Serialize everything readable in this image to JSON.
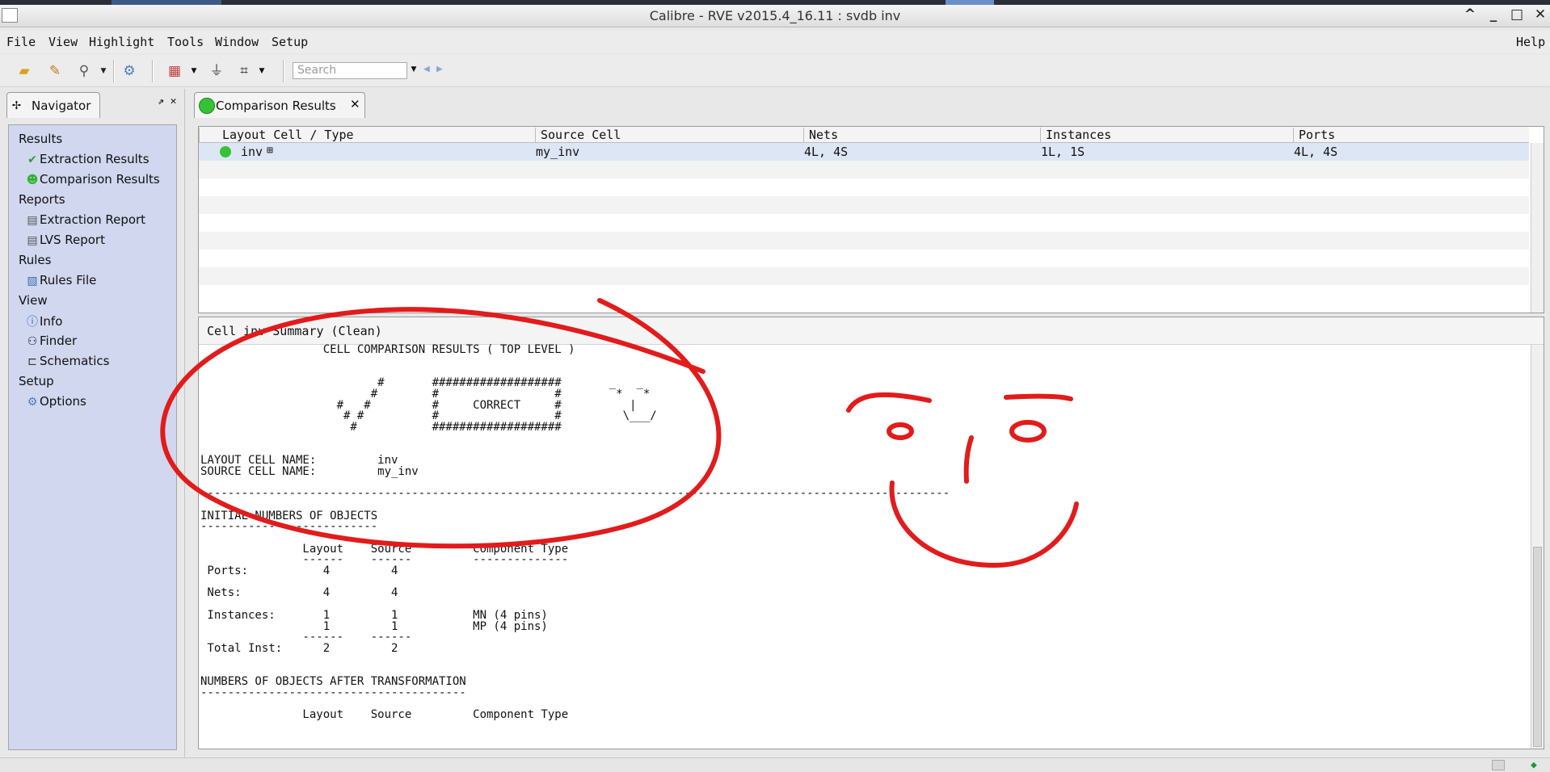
{
  "window": {
    "title": "Calibre - RVE v2015.4_16.11 : svdb inv",
    "controls": [
      "^",
      "_",
      "□",
      "✕"
    ]
  },
  "menu": [
    {
      "label": "File",
      "mnemonic": "F"
    },
    {
      "label": "View",
      "mnemonic": "V"
    },
    {
      "label": "Highlight",
      "mnemonic": "H"
    },
    {
      "label": "Tools",
      "mnemonic": "T"
    },
    {
      "label": "Window",
      "mnemonic": "W"
    },
    {
      "label": "Setup",
      "mnemonic": "S"
    },
    {
      "label": "Help",
      "mnemonic": "H"
    }
  ],
  "toolbar": {
    "search_placeholder": "Search",
    "icons": [
      "open-folder-icon",
      "highlight-icon",
      "zoom-icon",
      "settings-icon",
      "color-icon",
      "filter-icon",
      "schematic-filter-icon"
    ]
  },
  "navigator": {
    "tab_label": "Navigator",
    "sections": [
      {
        "label": "Results",
        "items": [
          {
            "label": "Extraction Results",
            "icon": "check-icon"
          },
          {
            "label": "Comparison Results",
            "icon": "smiley-icon"
          }
        ]
      },
      {
        "label": "Reports",
        "items": [
          {
            "label": "Extraction Report",
            "icon": "report-icon"
          },
          {
            "label": "LVS Report",
            "icon": "report-icon"
          }
        ]
      },
      {
        "label": "Rules",
        "items": [
          {
            "label": "Rules File",
            "icon": "rules-icon"
          }
        ]
      },
      {
        "label": "View",
        "items": [
          {
            "label": "Info",
            "icon": "info-icon"
          },
          {
            "label": "Finder",
            "icon": "binoculars-icon"
          },
          {
            "label": "Schematics",
            "icon": "schematic-icon"
          }
        ]
      },
      {
        "label": "Setup",
        "items": [
          {
            "label": "Options",
            "icon": "gear-icon"
          }
        ]
      }
    ]
  },
  "results_tab": {
    "label": "Comparison Results"
  },
  "table": {
    "headers": [
      "Layout Cell / Type",
      "Source Cell",
      "Nets",
      "Instances",
      "Ports"
    ],
    "rows": [
      {
        "layout": "inv",
        "source": "my_inv",
        "nets": "4L, 4S",
        "instances": "1L, 1S",
        "ports": "4L, 4S"
      }
    ]
  },
  "summary": {
    "title": "Cell inv Summary (Clean)",
    "report": "                  CELL COMPARISON RESULTS ( TOP LEVEL )\n\n\n                          #       ###################       _   _\n                         #        #                 #        *   *\n                    #   #         #     CORRECT     #          |\n                     # #          #                 #         \\___/\n                      #           ###################\n\n\nLAYOUT CELL NAME:         inv\nSOURCE CELL NAME:         my_inv\n\n--------------------------------------------------------------------------------------------------------------\n\nINITIAL NUMBERS OF OBJECTS\n--------------------------\n\n               Layout    Source         Component Type\n               ------    ------         --------------\n Ports:           4         4\n\n Nets:            4         4\n\n Instances:       1         1           MN (4 pins)\n                  1         1           MP (4 pins)\n               ------    ------\n Total Inst:      2         2\n\n\nNUMBERS OF OBJECTS AFTER TRANSFORMATION\n---------------------------------------\n\n               Layout    Source         Component Type"
  },
  "colors": {
    "nav_bg": "#d0d7ee",
    "selected_row": "#dde6f4",
    "annotation": "#e21b1b",
    "status_ok": "#36c236"
  }
}
